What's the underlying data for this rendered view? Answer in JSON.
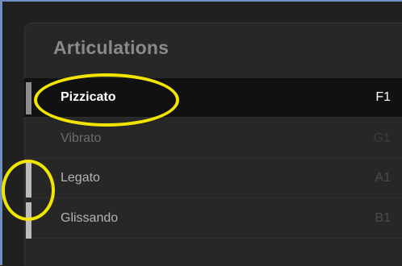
{
  "panel": {
    "title": "Articulations"
  },
  "articulations": [
    {
      "label": "Pizzicato",
      "key": "F1",
      "state": "selected"
    },
    {
      "label": "Vibrato",
      "key": "G1",
      "state": "dim"
    },
    {
      "label": "Legato",
      "key": "A1",
      "state": "normal"
    },
    {
      "label": "Glissando",
      "key": "B1",
      "state": "normal"
    }
  ],
  "highlight_color": "#f2e600",
  "accent_border_color": "#6d8fc4"
}
